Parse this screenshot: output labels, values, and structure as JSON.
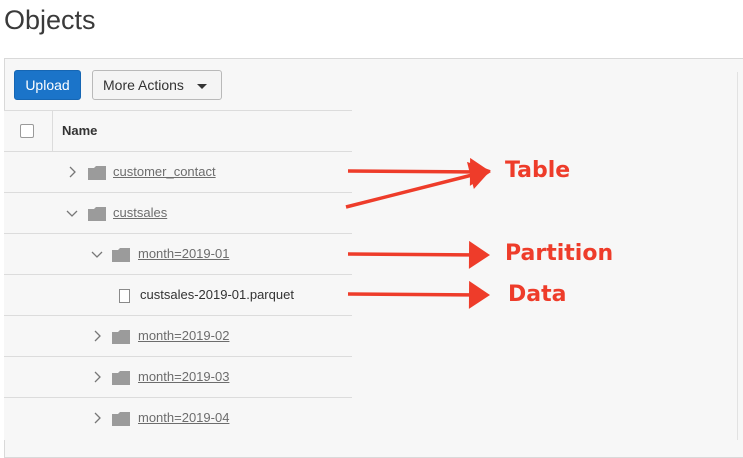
{
  "page": {
    "title": "Objects"
  },
  "toolbar": {
    "upload_label": "Upload",
    "more_actions_label": "More Actions"
  },
  "table": {
    "header_name": "Name",
    "rows": [
      {
        "name": "customer_contact",
        "type": "folder",
        "expanded": false,
        "level": 0
      },
      {
        "name": "custsales",
        "type": "folder",
        "expanded": true,
        "level": 0
      },
      {
        "name": "month=2019-01",
        "type": "folder",
        "expanded": true,
        "level": 1
      },
      {
        "name": "custsales-2019-01.parquet",
        "type": "file",
        "level": 2
      },
      {
        "name": "month=2019-02",
        "type": "folder",
        "expanded": false,
        "level": 1
      },
      {
        "name": "month=2019-03",
        "type": "folder",
        "expanded": false,
        "level": 1
      },
      {
        "name": "month=2019-04",
        "type": "folder",
        "expanded": false,
        "level": 1
      }
    ]
  },
  "annotations": {
    "table": "Table",
    "partition": "Partition",
    "data": "Data",
    "color": "#ee3c2a"
  },
  "icons": {
    "folder": "folder-icon",
    "file": "file-icon",
    "collapsed": "chevron-right-icon",
    "expanded": "chevron-down-icon",
    "dropdown": "caret-down-icon"
  }
}
